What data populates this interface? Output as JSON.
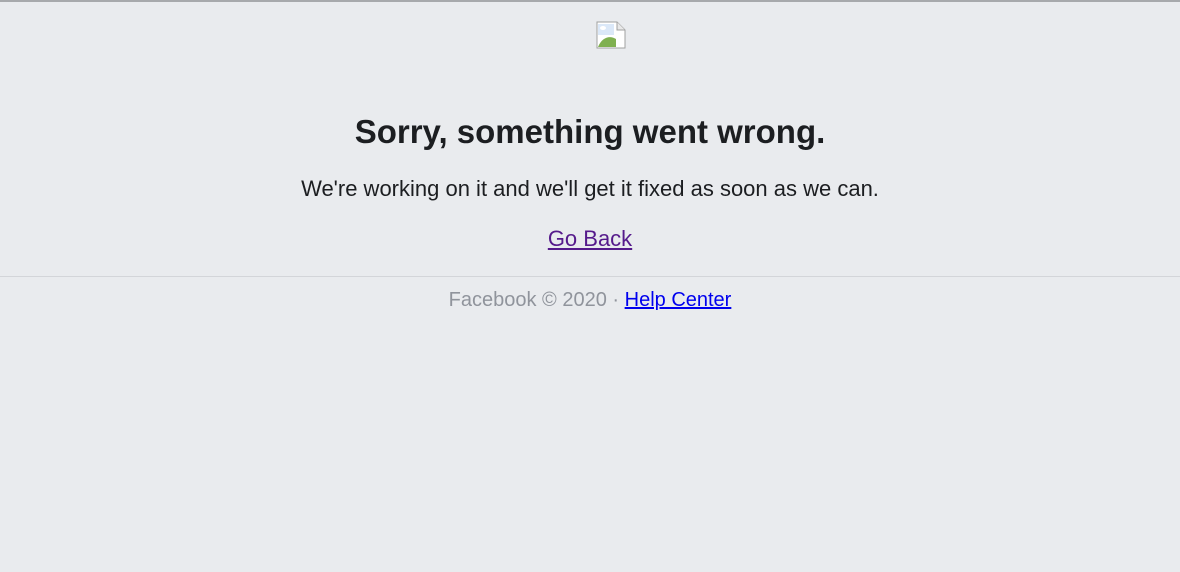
{
  "error": {
    "title": "Sorry, something went wrong.",
    "message": "We're working on it and we'll get it fixed as soon as we can.",
    "go_back_label": "Go Back"
  },
  "footer": {
    "copyright": "Facebook © 2020",
    "separator": " · ",
    "help_center_label": "Help Center"
  },
  "colors": {
    "background": "#e9ebee",
    "text": "#1c1e21",
    "visited_link": "#551a8b",
    "link": "#0000ee",
    "footer_text": "#90949c"
  },
  "icons": {
    "logo": "broken-image-icon"
  }
}
